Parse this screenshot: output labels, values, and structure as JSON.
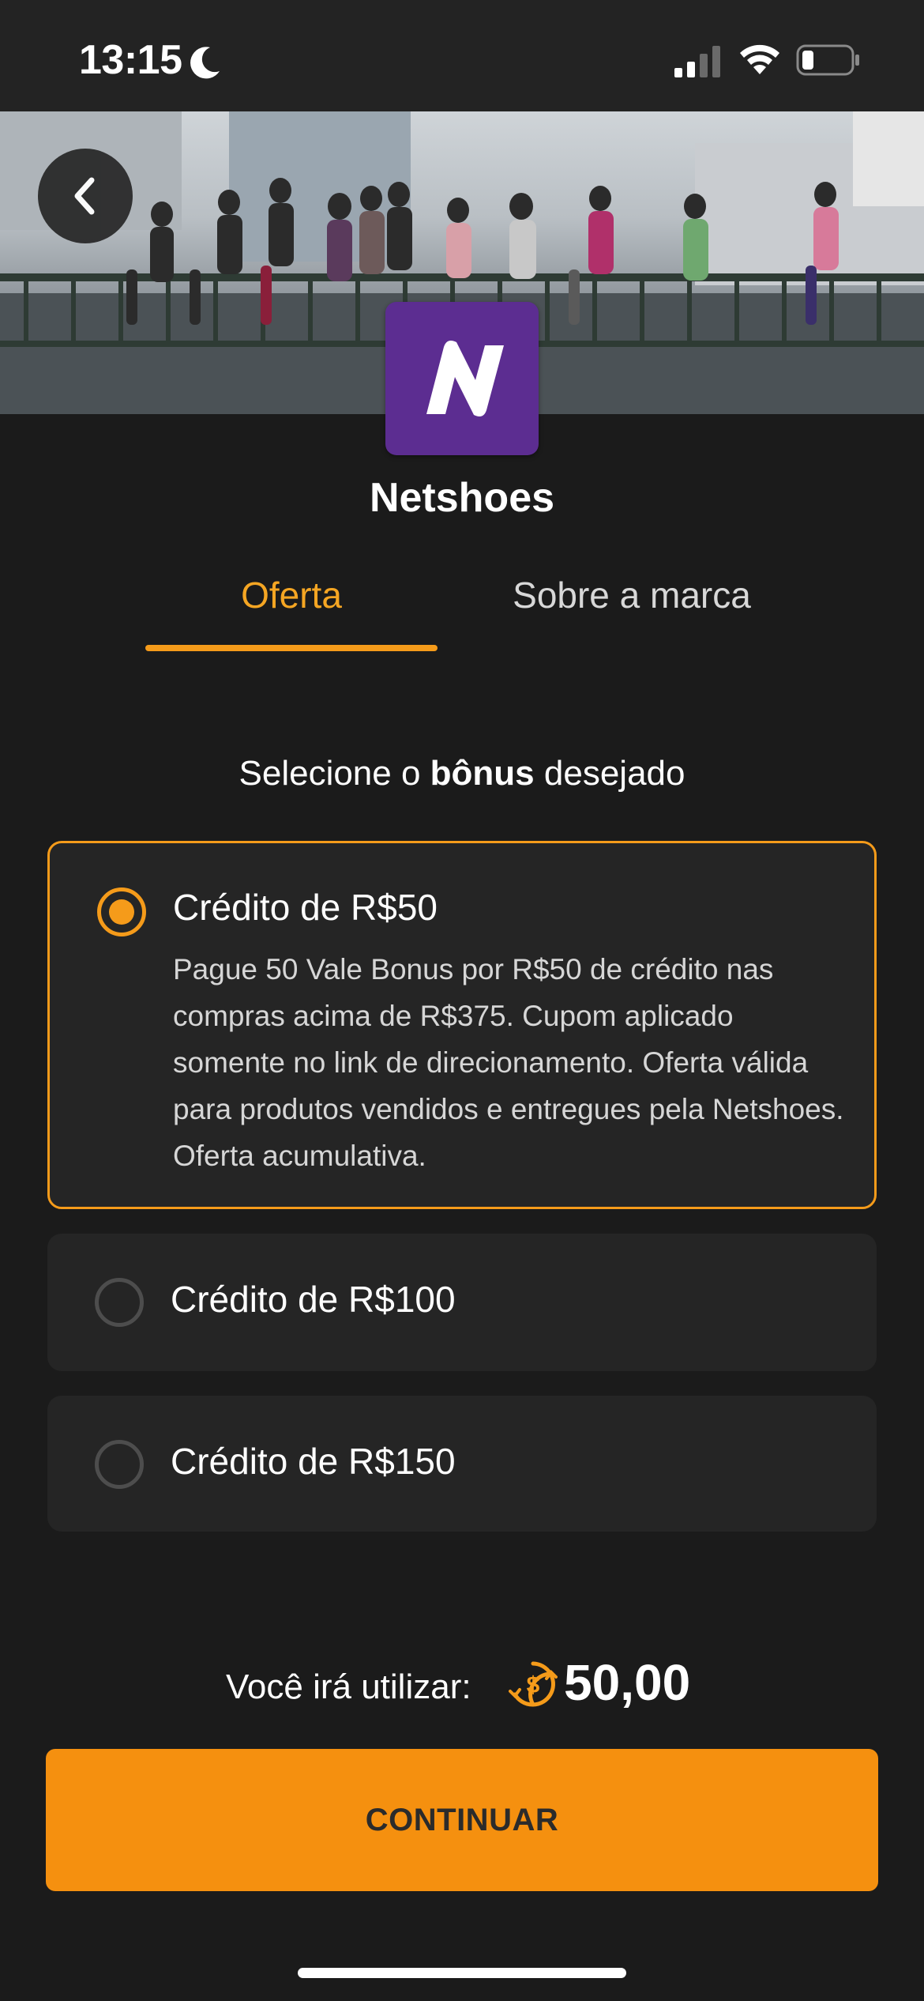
{
  "status_bar": {
    "time": "13:15"
  },
  "brand": {
    "name": "Netshoes",
    "logo_letter": "N",
    "logo_color": "#5c2d91"
  },
  "tabs": [
    {
      "label": "Oferta",
      "active": true
    },
    {
      "label": "Sobre a marca",
      "active": false
    }
  ],
  "selection": {
    "heading_prefix": "Selecione o ",
    "heading_bold": "bônus",
    "heading_suffix": " desejado"
  },
  "options": [
    {
      "title": "Crédito de R$50",
      "selected": true,
      "description": "Pague 50 Vale Bonus por R$50 de crédito nas compras acima de R$375. Cupom aplicado somente no link de direcionamento. Oferta válida para produtos vendidos e entregues pela Netshoes. Oferta acumulativa."
    },
    {
      "title": "Crédito de R$100",
      "selected": false
    },
    {
      "title": "Crédito de R$150",
      "selected": false
    }
  ],
  "summary": {
    "label": "Você irá utilizar:",
    "amount": "50,00"
  },
  "continue_label": "CONTINUAR",
  "colors": {
    "accent": "#f59b1a",
    "background": "#1b1b1b",
    "card": "#252525",
    "button": "#f5900f"
  },
  "icons": [
    "moon-icon",
    "signal-icon",
    "wifi-icon",
    "battery-icon",
    "back-arrow-icon",
    "coin-icon"
  ]
}
